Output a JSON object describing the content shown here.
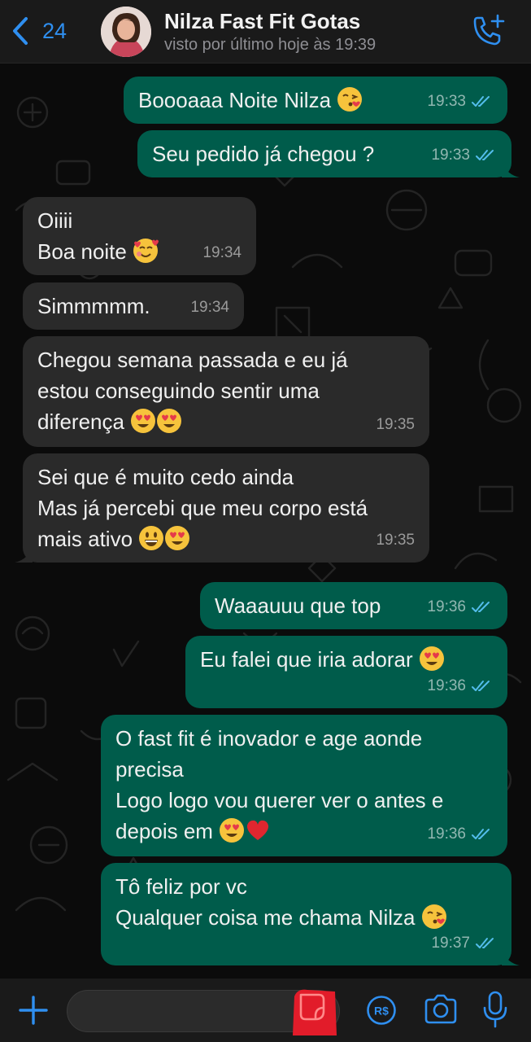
{
  "header": {
    "back_count": "24",
    "contact_name": "Nilza Fast Fit Gotas",
    "status": "visto por último hoje às 19:39"
  },
  "colors": {
    "accent": "#2f8ff0",
    "outgoing_bubble": "#005c4b",
    "incoming_bubble": "#2a2a2a",
    "read_ticks": "#53bdeb"
  },
  "messages": [
    {
      "direction": "out",
      "text": "Boooaaa Noite Nilza",
      "emoji": [
        "face-blowing-kiss"
      ],
      "time": "19:33",
      "status": "read"
    },
    {
      "direction": "out",
      "text": "Seu pedido já chegou ?",
      "emoji": [],
      "time": "19:33",
      "status": "read"
    },
    {
      "direction": "in",
      "text_lines": [
        "Oiiii",
        "Boa noite"
      ],
      "emoji": [
        "smiling-face-with-hearts"
      ],
      "time": "19:34"
    },
    {
      "direction": "in",
      "text": "Simmmmm.",
      "emoji": [],
      "time": "19:34"
    },
    {
      "direction": "in",
      "text_lines": [
        "Chegou semana passada e eu já",
        "estou conseguindo sentir uma",
        "diferença"
      ],
      "emoji": [
        "heart-eyes",
        "heart-eyes"
      ],
      "time": "19:35"
    },
    {
      "direction": "in",
      "text_lines": [
        "Sei que é muito cedo ainda",
        "Mas já percebi que meu corpo está",
        "mais ativo"
      ],
      "emoji": [
        "grinning-face",
        "heart-eyes"
      ],
      "time": "19:35"
    },
    {
      "direction": "out",
      "text": "Waaauuu que top",
      "emoji": [],
      "time": "19:36",
      "status": "read"
    },
    {
      "direction": "out",
      "text": "Eu falei que iria adorar",
      "emoji": [
        "heart-eyes"
      ],
      "time": "19:36",
      "status": "read"
    },
    {
      "direction": "out",
      "text_lines": [
        "O fast fit é inovador e age aonde",
        "precisa",
        "Logo logo vou querer ver o antes e",
        "depois em"
      ],
      "emoji": [
        "heart-eyes",
        "red-heart"
      ],
      "time": "19:36",
      "status": "read"
    },
    {
      "direction": "out",
      "text_lines": [
        "Tô feliz por vc",
        "Qualquer coisa me chama Nilza"
      ],
      "emoji": [
        "face-blowing-kiss"
      ],
      "time": "19:37",
      "status": "read"
    }
  ],
  "input_bar": {
    "icons": [
      "plus-icon",
      "sticker-icon",
      "payment-icon",
      "camera-icon",
      "microphone-icon"
    ],
    "payment_label": "R$"
  }
}
